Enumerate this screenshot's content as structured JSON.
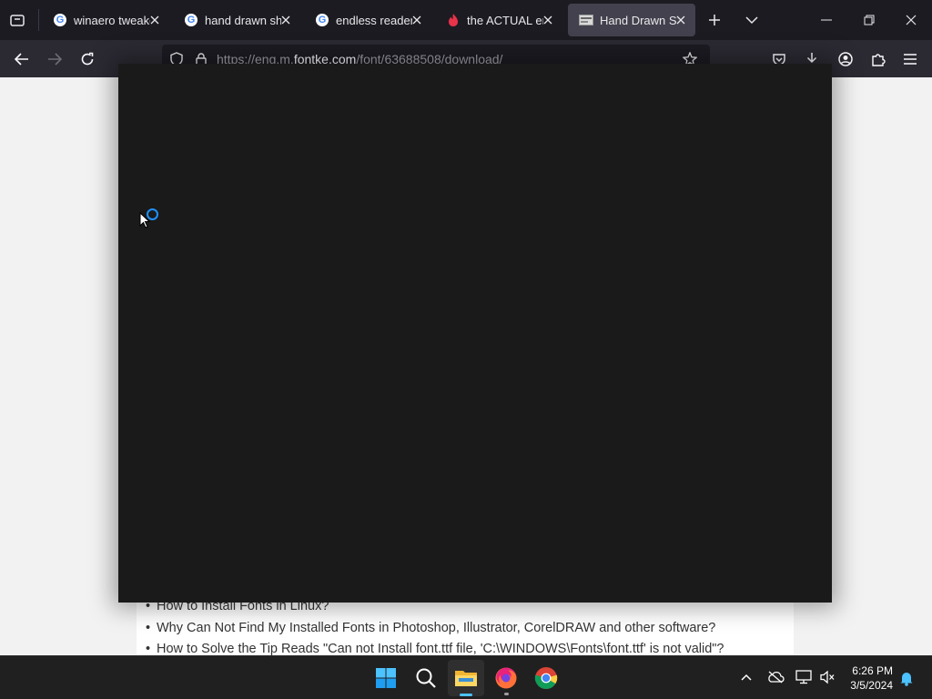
{
  "browser": {
    "tabs": [
      {
        "title": "winaero tweaker",
        "favicon": "google-icon",
        "active": false
      },
      {
        "title": "hand drawn shapes",
        "favicon": "google-icon",
        "active": false
      },
      {
        "title": "endless reader font",
        "favicon": "google-icon",
        "active": false
      },
      {
        "title": "the ACTUAL endless",
        "favicon": "flame-icon",
        "active": false
      },
      {
        "title": "Hand Drawn Shapes",
        "favicon": "page-thumbnail-icon",
        "active": true
      }
    ],
    "url_prefix": "https://eng.m.",
    "url_domain": "fontke.com",
    "url_path": "/font/63688508/download/"
  },
  "page": {
    "links": [
      "How to Install Fonts in Linux?",
      "Why Can Not Find My Installed Fonts in Photoshop, Illustrator, CorelDRAW and other software?",
      "How to Solve the Tip Reads \"Can not Install font.ttf file, 'C:\\WINDOWS\\Fonts\\font.ttf' is not valid\"?"
    ]
  },
  "taskbar": {
    "apps": [
      "windows-start-icon",
      "search-icon",
      "file-explorer-icon",
      "firefox-icon",
      "chrome-icon"
    ],
    "time": "6:26 PM",
    "date": "3/5/2024"
  },
  "colors": {
    "tab_strip": "#1c1b22",
    "toolbar": "#2b2a33",
    "overlay": "#1a1a1a",
    "spinner": "#1e90ff",
    "taskbar": "#202020"
  }
}
